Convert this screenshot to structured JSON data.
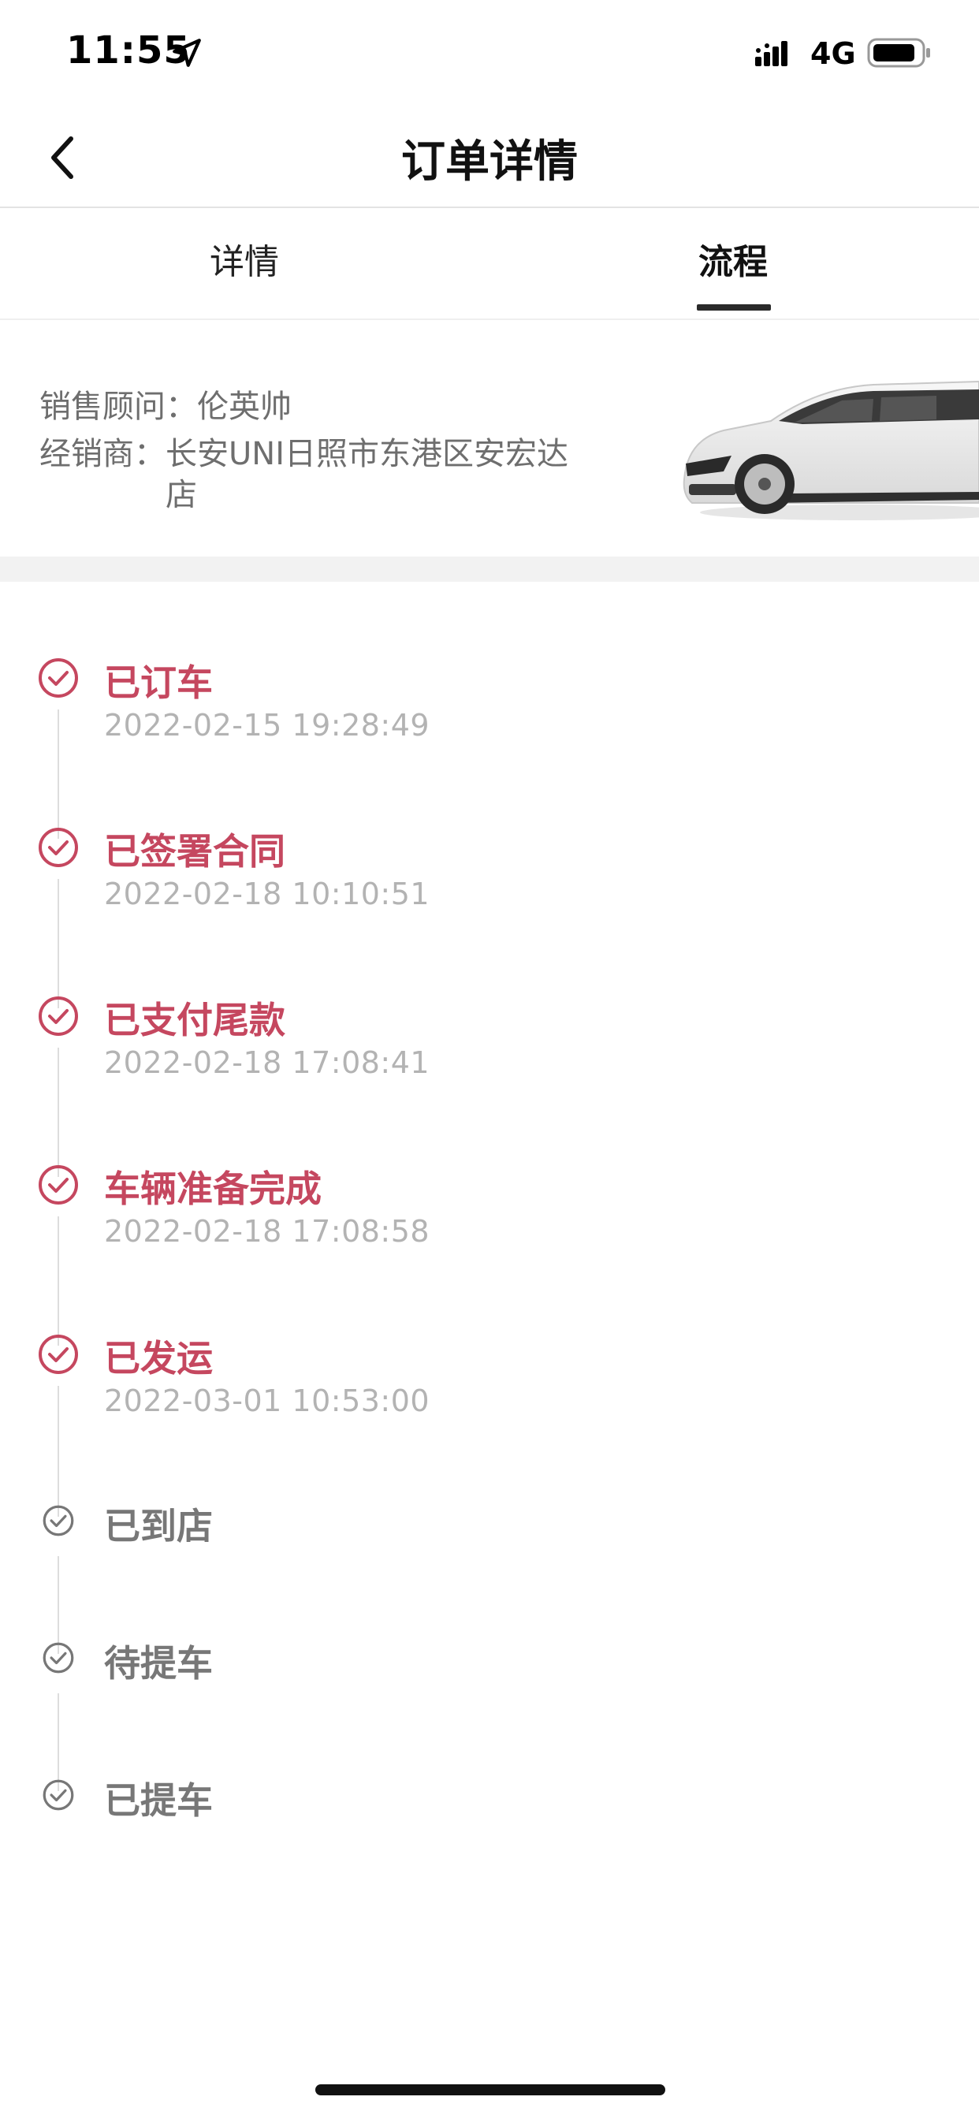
{
  "status_bar": {
    "time": "11:55",
    "network": "4G"
  },
  "nav": {
    "title": "订单详情"
  },
  "tabs": [
    {
      "label": "详情",
      "active": false
    },
    {
      "label": "流程",
      "active": true
    }
  ],
  "info": {
    "advisor_label": "销售顾问：",
    "advisor_value": "伦英帅",
    "dealer_label": "经销商：",
    "dealer_value": "长安UNI日照市东港区安宏达店"
  },
  "steps": [
    {
      "title": "已订车",
      "time": "2022-02-15 19:28:49",
      "status": "done"
    },
    {
      "title": "已签署合同",
      "time": "2022-02-18 10:10:51",
      "status": "done"
    },
    {
      "title": "已支付尾款",
      "time": "2022-02-18 17:08:41",
      "status": "done"
    },
    {
      "title": "车辆准备完成",
      "time": "2022-02-18 17:08:58",
      "status": "done"
    },
    {
      "title": "已发运",
      "time": "2022-03-01 10:53:00",
      "status": "done"
    },
    {
      "title": "已到店",
      "time": "",
      "status": "pending"
    },
    {
      "title": "待提车",
      "time": "",
      "status": "pending"
    },
    {
      "title": "已提车",
      "time": "",
      "status": "pending"
    }
  ],
  "colors": {
    "done": "#c5475f",
    "pending": "#777777",
    "time": "#b3b3b3"
  }
}
